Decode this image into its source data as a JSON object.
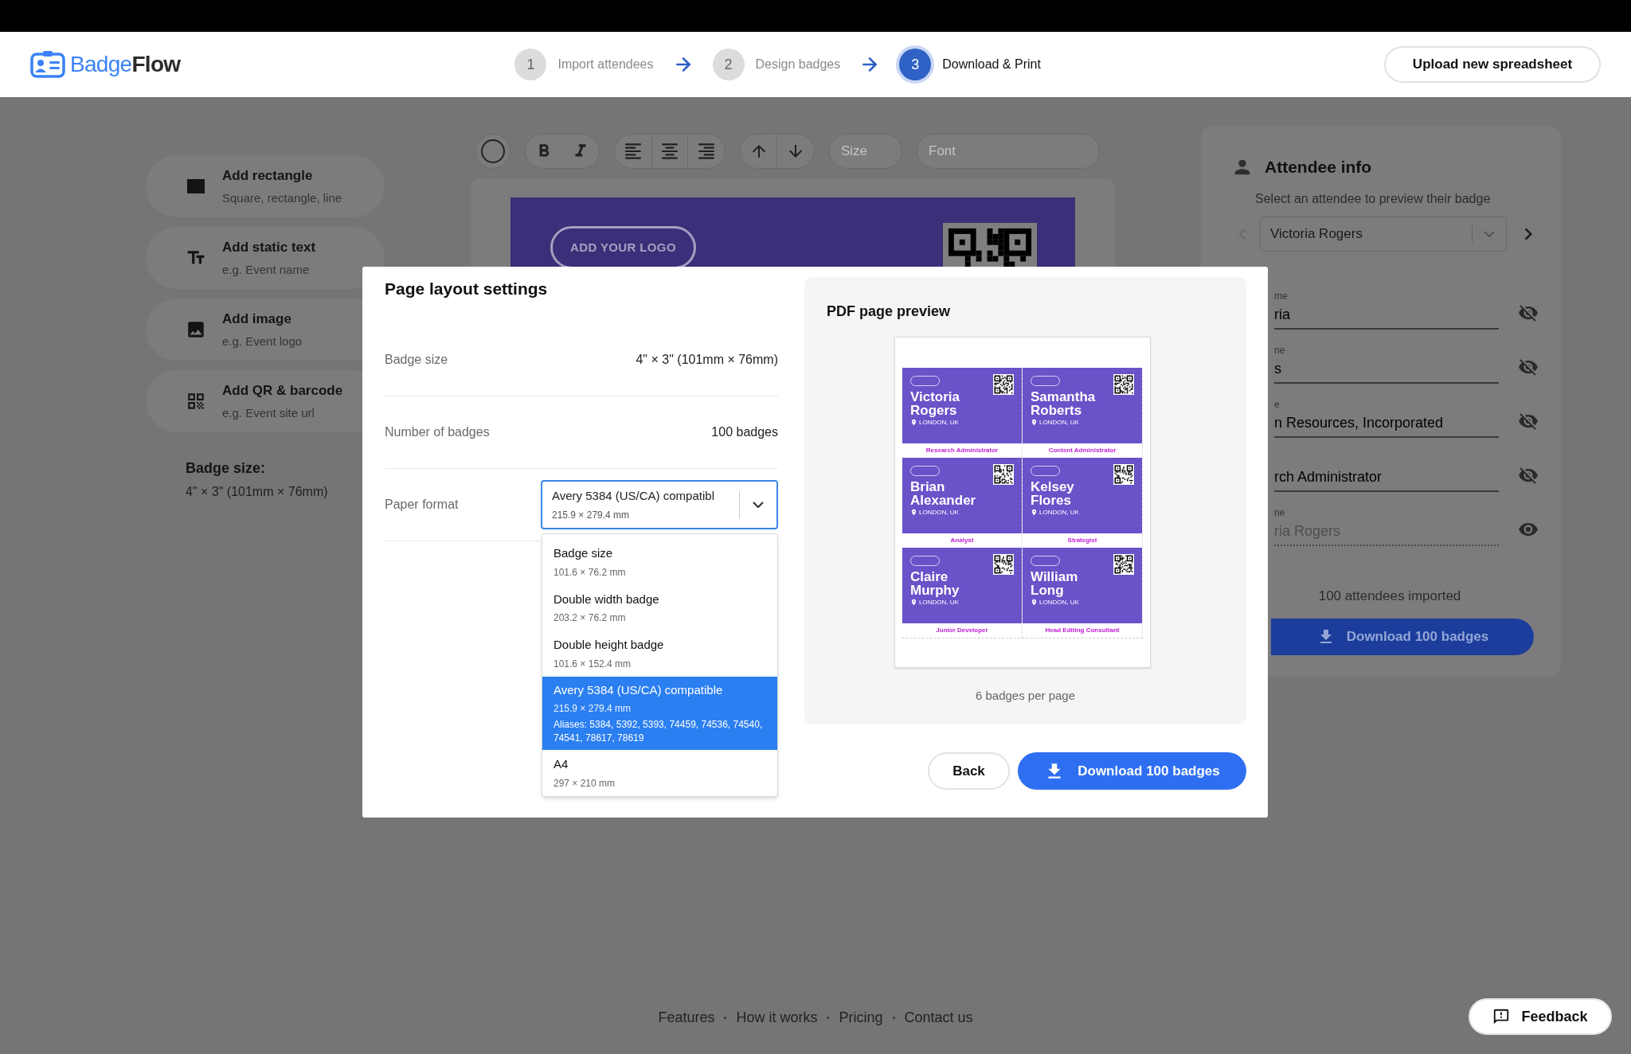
{
  "header": {
    "logo": {
      "first": "Badge",
      "second": "Flow"
    },
    "steps": [
      {
        "number": "1",
        "label": "Import attendees",
        "selected": false
      },
      {
        "number": "2",
        "label": "Design badges",
        "selected": false
      },
      {
        "number": "3",
        "label": "Download & Print",
        "selected": true
      }
    ],
    "upload_button": "Upload new spreadsheet"
  },
  "sidebar": {
    "tools": [
      {
        "kind": "rectangle",
        "title": "Add rectangle",
        "subtitle": "Square, rectangle, line"
      },
      {
        "kind": "text",
        "title": "Add static text",
        "subtitle": "e.g. Event name"
      },
      {
        "kind": "image",
        "title": "Add image",
        "subtitle": "e.g. Event logo"
      },
      {
        "kind": "qr",
        "title": "Add QR & barcode",
        "subtitle": "e.g. Event site url"
      }
    ],
    "badge_size_label": "Badge size:",
    "badge_size_value": "4\" × 3\" (101mm × 76mm)"
  },
  "toolbar": {
    "size_placeholder": "Size",
    "font_placeholder": "Font"
  },
  "canvas": {
    "logo_button": "ADD YOUR LOGO"
  },
  "attendee_panel": {
    "title": "Attendee info",
    "subtitle": "Select an attendee to preview their badge",
    "selected_attendee": "Victoria Rogers",
    "fields": [
      {
        "label": "me",
        "value": "ria",
        "visible": false
      },
      {
        "label": "ne",
        "value": "s",
        "visible": false
      },
      {
        "label": "e",
        "value": "n Resources, Incorporated",
        "visible": false
      },
      {
        "value": "rch Administrator",
        "visible": false
      },
      {
        "label": "ne",
        "placeholder": "ria Rogers",
        "visible": true
      }
    ],
    "count": "100 attendees imported",
    "download_button": "Download 100 badges"
  },
  "modal": {
    "title": "Page layout settings",
    "rows": [
      {
        "label": "Badge size",
        "value": "4\" × 3\" (101mm × 76mm)"
      },
      {
        "label": "Number of badges",
        "value": "100 badges"
      }
    ],
    "paper_format": {
      "label": "Paper format",
      "value_title": "Avery 5384 (US/CA) compatibl",
      "value_size": "215.9 × 279.4 mm",
      "expanded": true,
      "options": [
        {
          "title": "Badge size",
          "size": "101.6 × 76.2 mm",
          "selected": false
        },
        {
          "title": "Double width badge",
          "size": "203.2 × 76.2 mm",
          "selected": false
        },
        {
          "title": "Double height badge",
          "size": "101.6 × 152.4 mm",
          "selected": false
        },
        {
          "title": "Avery 5384 (US/CA) compatible",
          "size": "215.9 × 279.4 mm",
          "aliases": "Aliases: 5384, 5392, 5393, 74459, 74536, 74540, 74541, 78617, 78619",
          "selected": true
        },
        {
          "title": "A4",
          "size": "297 × 210 mm",
          "selected": false
        }
      ]
    },
    "preview": {
      "title": "PDF page preview",
      "badges": [
        {
          "first": "Victoria",
          "last": "Rogers",
          "location": "LONDON, UK",
          "role": "Research Administrator"
        },
        {
          "first": "Samantha",
          "last": "Roberts",
          "location": "LONDON, UK",
          "role": "Content Administrator"
        },
        {
          "first": "Brian",
          "last": "Alexander",
          "location": "LONDON, UK",
          "role": "Analyst"
        },
        {
          "first": "Kelsey",
          "last": "Flores",
          "location": "LONDON, UK",
          "role": "Strategist"
        },
        {
          "first": "Claire",
          "last": "Murphy",
          "location": "LONDON, UK",
          "role": "Junior Developer"
        },
        {
          "first": "William",
          "last": "Long",
          "location": "LONDON, UK",
          "role": "Head Editing Consultant"
        }
      ],
      "caption": "6 badges per page"
    },
    "back_button": "Back",
    "download_button": "Download 100 badges"
  },
  "footer": {
    "links": [
      "Features",
      "How it works",
      "Pricing",
      "Contact us"
    ],
    "feedback_button": "Feedback"
  }
}
